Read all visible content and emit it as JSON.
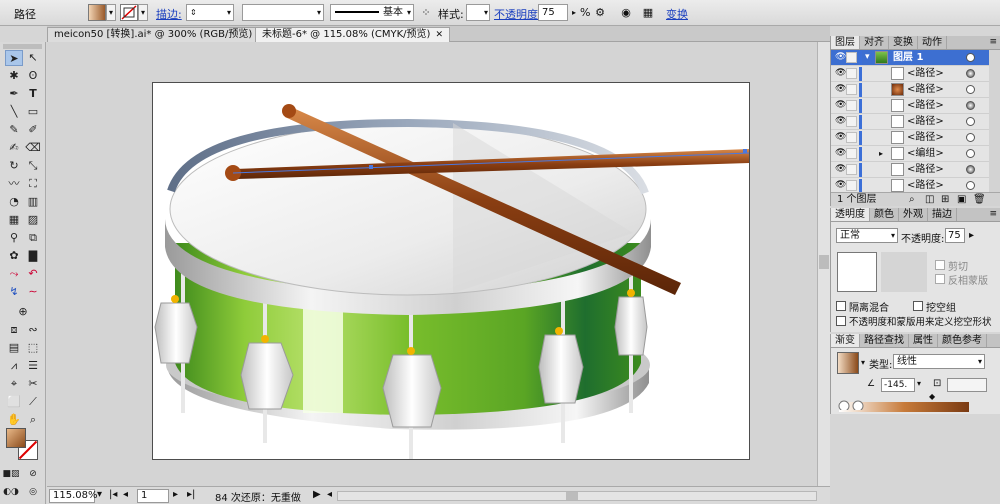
{
  "colors": {
    "selection_blue": "#3d6fd1",
    "drum_green": "#6fb52a",
    "stick_brown": "#8a3e12"
  },
  "control_bar": {
    "object_type": "路径",
    "stroke_label": "描边:",
    "stroke_profile": "基本",
    "style_label": "样式:",
    "opacity_label": "不透明度:",
    "opacity_value": "75",
    "percent": "%",
    "transform_label": "变换"
  },
  "doc_tabs": [
    {
      "label": "meicon50 [转换].ai* @ 300% (RGB/预览)"
    },
    {
      "label": "未标题-6* @ 115.08% (CMYK/预览)"
    }
  ],
  "status_bar": {
    "zoom": "115.08%",
    "page": "1",
    "status_text": "84 次还原：无重做"
  },
  "layers_panel": {
    "tabs": [
      "图层",
      "对齐",
      "变换",
      "动作"
    ],
    "rows": [
      {
        "name": "图层 1",
        "kind": "layer"
      },
      {
        "name": "<路径>",
        "target": "filled"
      },
      {
        "name": "<路径>",
        "target": "empty",
        "thumb": "brown"
      },
      {
        "name": "<路径>",
        "target": "filled"
      },
      {
        "name": "<路径>",
        "target": "empty"
      },
      {
        "name": "<路径>",
        "target": "empty"
      },
      {
        "name": "<编组>",
        "target": "empty"
      },
      {
        "name": "<路径>",
        "target": "filled"
      },
      {
        "name": "<路径>",
        "target": "empty"
      }
    ],
    "footer": "1 个图层"
  },
  "transparency_panel": {
    "tabs": [
      "透明度",
      "颜色",
      "外观",
      "描边"
    ],
    "blend_mode": "正常",
    "opacity_label": "不透明度:",
    "opacity_value": "75",
    "clip_label": "剪切",
    "invert_mask_label": "反相蒙版",
    "isolate_blending_label": "隔离混合",
    "knockout_group_label": "挖空组",
    "opacity_mask_label": "不透明度和蒙版用来定义挖空形状"
  },
  "gradient_panel": {
    "tabs": [
      "渐变",
      "路径查找",
      "属性",
      "颜色参考"
    ],
    "type_label": "类型:",
    "type_value": "线性",
    "angle_value": "-145."
  }
}
